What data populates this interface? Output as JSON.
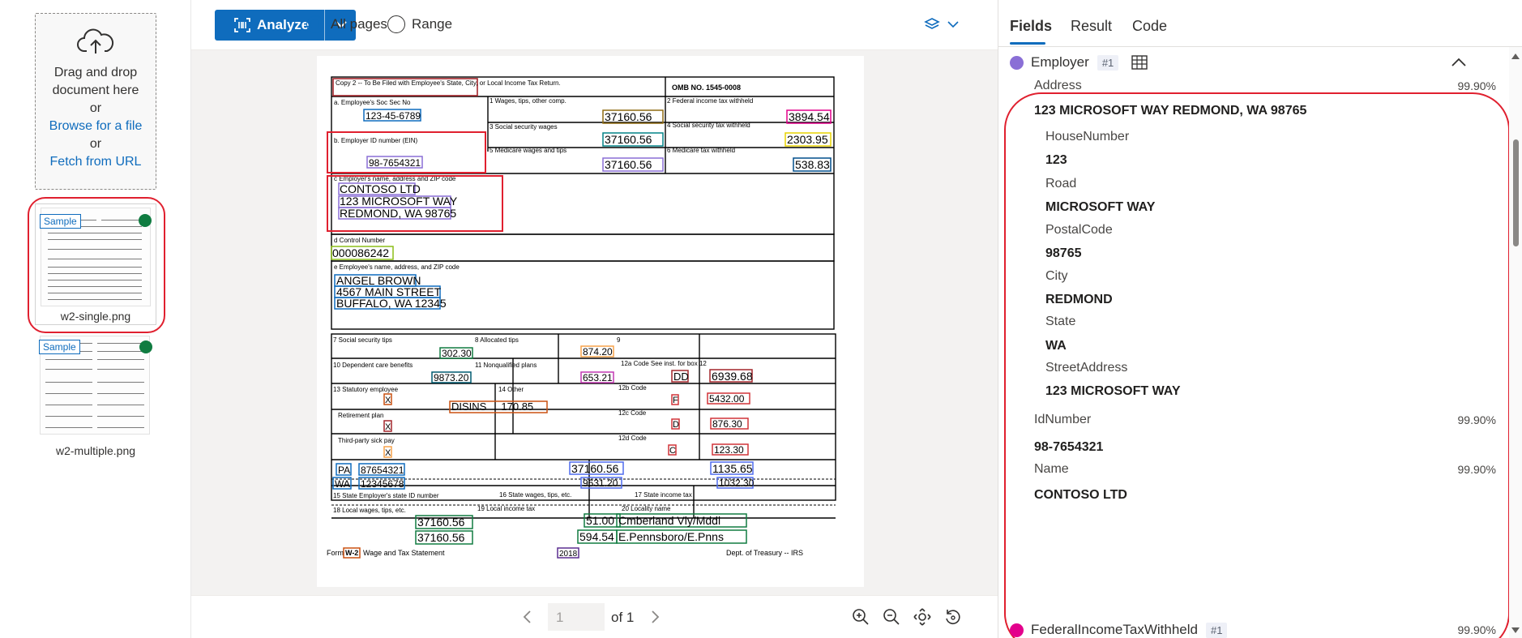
{
  "left": {
    "dropzone": {
      "line1": "Drag and drop",
      "line2": "document here",
      "or1": "or",
      "browse": "Browse for a file",
      "or2": "or",
      "fetch": "Fetch from URL"
    },
    "files": [
      {
        "badge": "Sample",
        "name": "w2-single.png",
        "status_color": "#107c41",
        "selected": true
      },
      {
        "badge": "Sample",
        "name": "w2-multiple.png",
        "status_color": "#107c41",
        "selected": false
      }
    ]
  },
  "toolbar": {
    "analyze_label": "Analyze",
    "radio_all": "All pages",
    "radio_range": "Range",
    "selected_radio": "All pages",
    "accent": "#0f6cbd"
  },
  "document": {
    "copy_header": "Copy 2 -- To Be Filed with Employee's State, City, or Local Income Tax Return.",
    "omb": "OMB NO. 1545-0008",
    "ssn_label": "a. Employee's Soc Sec No",
    "ssn": "123-45-6789",
    "wages_label": "1 Wages, tips, other comp.",
    "wages": "37160.56",
    "fed_tax_label": "2 Federal income tax withheld",
    "fed_tax": "3894.54",
    "ss_wages_label": "3 Social security wages",
    "ss_wages": "37160.56",
    "ss_tax_label": "4 Social security tax withheld",
    "ss_tax": "2303.95",
    "ein_label": "b. Employer ID number (EIN)",
    "ein": "98-7654321",
    "med_wages_label": "5 Medicare wages and tips",
    "med_wages": "37160.56",
    "med_tax_label": "6 Medicare tax withheld",
    "med_tax": "538.83",
    "employer_label": "c Employer's name, address and ZIP code",
    "employer_lines": [
      "CONTOSO LTD",
      "123 MICROSOFT WAY",
      "REDMOND, WA 98765"
    ],
    "control_label": "d Control Number",
    "control": "000086242",
    "employee_label": "e Employee's name, address, and ZIP code",
    "employee_lines": [
      "ANGEL BROWN",
      "4567 MAIN STREET",
      "BUFFALO, WA 12345"
    ],
    "ss_tips_label": "7 Social security tips",
    "ss_tips": "302.30",
    "alloc_tips_label": "8 Allocated tips",
    "alloc_tips": "874.20",
    "box9_label": "9",
    "dep_care_label": "10 Dependent care benefits",
    "dep_care": "9873.20",
    "nonqual_label": "11 Nonqualified plans",
    "nonqual": "653.21",
    "box12a_label": "12a Code See inst. for box 12",
    "box12a_code": "DD",
    "box12a_amt": "6939.68",
    "stat_emp_label": "13 Statutory employee",
    "other_label": "14 Other",
    "other_value": "DISINS     170.85",
    "box12b_label": "12b Code",
    "box12b_code": "F",
    "box12b_amt": "5432.00",
    "retire_label": "Retirement plan",
    "box12c_label": "12c Code",
    "box12c_code": "D",
    "box12c_amt": "876.30",
    "sick_label": "Third-party sick pay",
    "box12d_label": "12d Code",
    "box12d_code": "C",
    "box12d_amt": "123.30",
    "check_mark": "X",
    "state1": "PA",
    "state1_id": "87654321",
    "state2": "WA",
    "state2_id": "12345678",
    "state_wages1": "37160.56",
    "state_wages2": "9631.20",
    "state_tax1": "1135.65",
    "state_tax2": "1032.30",
    "box15_label": "15 State Employer's state ID number",
    "box16_label": "16 State wages, tips, etc.",
    "box17_label": "17 State income tax",
    "box18_label": "18 Local wages, tips, etc.",
    "box19_label": "19 Local income tax",
    "box20_label": "20 Locality name",
    "local_wages1": "37160.56",
    "local_wages2": "37160.56",
    "local_tax1": "51.00",
    "local_tax2": "594.54",
    "locality1": "Cmberland Vly/Mddl",
    "locality2": "E.Pennsboro/E.Pnns",
    "form_label_pre": "Form",
    "form_label_w2": "W-2",
    "form_label_post": "Wage and Tax Statement",
    "year": "2018",
    "treasury": "Dept. of Treasury -- IRS"
  },
  "pager": {
    "page_value": "1",
    "of_label": "of 1"
  },
  "right": {
    "tabs": [
      "Fields",
      "Result",
      "Code"
    ],
    "active_tab": "Fields",
    "employer_group": {
      "name": "Employer",
      "tag": "#1",
      "dot_color": "#8a6fd6"
    },
    "fields": {
      "address_label": "Address",
      "address_conf": "99.90%",
      "address_value": "123 MICROSOFT WAY REDMOND, WA 98765",
      "house_label": "HouseNumber",
      "house_value": "123",
      "road_label": "Road",
      "road_value": "MICROSOFT WAY",
      "postal_label": "PostalCode",
      "postal_value": "98765",
      "city_label": "City",
      "city_value": "REDMOND",
      "state_label": "State",
      "state_value": "WA",
      "street_label": "StreetAddress",
      "street_value": "123 MICROSOFT WAY",
      "id_label": "IdNumber",
      "id_conf": "99.90%",
      "id_value": "98-7654321",
      "name_label": "Name",
      "name_conf": "99.90%",
      "name_value": "CONTOSO LTD"
    },
    "next_group": {
      "name": "FederalIncomeTaxWithheld",
      "tag": "#1",
      "conf": "99.90%",
      "dot_color": "#e3008c"
    }
  }
}
